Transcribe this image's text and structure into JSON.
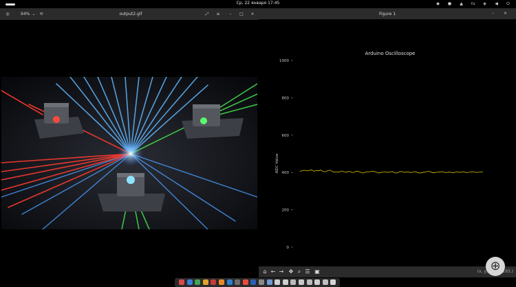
{
  "topbar": {
    "clock": "Ср, 22 января  17:45",
    "tray": [
      {
        "icon": "telegram-icon",
        "glyph": "◆"
      },
      {
        "icon": "steam-icon",
        "glyph": "●"
      },
      {
        "icon": "shield-icon",
        "glyph": "▲"
      },
      {
        "icon": "language-indicator",
        "glyph": "ru"
      },
      {
        "icon": "network-icon",
        "glyph": "◈"
      },
      {
        "icon": "volume-icon",
        "glyph": "◀"
      },
      {
        "icon": "power-icon",
        "glyph": "⏻"
      }
    ]
  },
  "viewer": {
    "title": "output2.gif",
    "zoom": "94%",
    "accent": "#2b2b2b"
  },
  "figure": {
    "title": "Figure 1",
    "toolbar": [
      {
        "icon": "home-icon",
        "glyph": "⌂"
      },
      {
        "icon": "back-arrow-icon",
        "glyph": "←"
      },
      {
        "icon": "forward-arrow-icon",
        "glyph": "→"
      },
      {
        "icon": "pan-icon",
        "glyph": "✥"
      },
      {
        "icon": "zoom-rect-icon",
        "glyph": "⌕"
      },
      {
        "icon": "configure-subplots-icon",
        "glyph": "☰"
      },
      {
        "icon": "save-icon",
        "glyph": "▣"
      }
    ],
    "coords": "(x, y) = (…, 193.)"
  },
  "chart_data": {
    "type": "line",
    "title": "Arduino Oscilloscope",
    "xlabel": "",
    "ylabel": "ADC Value",
    "ylim": [
      0,
      1000
    ],
    "yticks": [
      0,
      200,
      400,
      600,
      800,
      1000
    ],
    "grid": false,
    "line_color": "#d8c400",
    "series": [
      {
        "values": [
          405,
          410,
          412,
          408,
          411,
          414,
          407,
          410,
          409,
          413,
          405,
          404,
          410,
          412,
          405,
          401,
          404,
          402,
          408,
          404,
          401,
          406,
          403,
          399,
          405,
          407,
          402,
          397,
          400,
          404,
          403,
          407,
          406,
          401,
          397,
          400,
          403,
          403,
          400,
          403,
          405,
          397,
          398,
          404,
          405,
          400,
          403,
          402,
          399,
          403,
          404,
          398,
          397,
          400,
          402,
          406,
          405,
          400,
          398,
          401,
          402,
          404,
          403,
          399,
          402,
          401,
          398,
          401,
          403,
          400,
          404,
          402,
          399,
          401,
          403,
          404,
          400,
          401,
          403,
          404
        ]
      }
    ]
  },
  "dock": [
    {
      "icon": "app-icon-1",
      "color": "#d84a4a"
    },
    {
      "icon": "app-icon-2",
      "color": "#3d7bd6"
    },
    {
      "icon": "app-icon-3",
      "color": "#3ea653"
    },
    {
      "icon": "app-icon-4",
      "color": "#e0a32a"
    },
    {
      "icon": "app-icon-5",
      "color": "#c53b3b"
    },
    {
      "icon": "app-icon-6",
      "color": "#e88a2a"
    },
    {
      "icon": "app-icon-7",
      "color": "#2c7fd0"
    },
    {
      "icon": "app-icon-8",
      "color": "#6c6c6c"
    },
    {
      "icon": "app-icon-9",
      "color": "#e84b3a"
    },
    {
      "icon": "app-icon-10",
      "color": "#2f5fb5"
    },
    {
      "icon": "app-icon-11",
      "color": "#8a8a8a"
    },
    {
      "icon": "app-icon-12",
      "color": "#6f9bd2"
    },
    {
      "icon": "app-icon-13",
      "color": "#d0d0d0"
    },
    {
      "icon": "app-icon-14",
      "color": "#cfcfcf"
    },
    {
      "icon": "app-icon-15",
      "color": "#bbbbbb"
    },
    {
      "icon": "app-icon-16",
      "color": "#c8c8c8"
    },
    {
      "icon": "app-icon-17",
      "color": "#bdbdbd"
    },
    {
      "icon": "app-icon-18",
      "color": "#cfcfcf"
    },
    {
      "icon": "app-icon-19",
      "color": "#bfbfbf"
    },
    {
      "icon": "app-icon-20",
      "color": "#d6d6d6"
    }
  ]
}
